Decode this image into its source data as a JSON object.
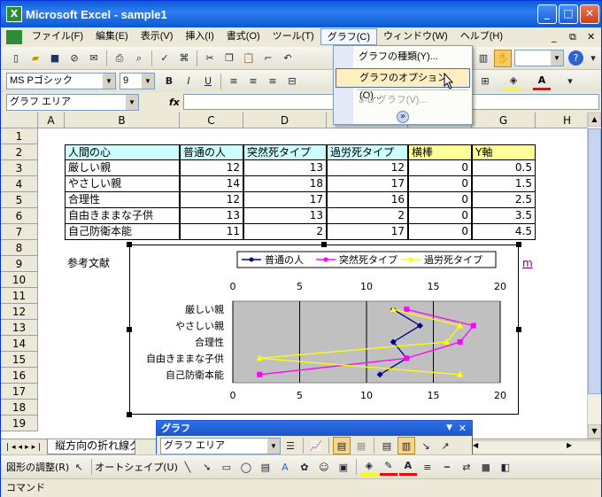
{
  "window": {
    "title": "Microsoft Excel - sample1",
    "app_icon": "X",
    "controls": [
      "_",
      "□",
      "✕"
    ]
  },
  "menubar": {
    "items": [
      "ファイル(F)",
      "編集(E)",
      "表示(V)",
      "挿入(I)",
      "書式(O)",
      "ツール(T)",
      "グラフ(C)",
      "ウィンドウ(W)",
      "ヘルプ(H)"
    ],
    "doc_controls": [
      "_",
      "⧉",
      "✕"
    ]
  },
  "formatting": {
    "font": "MS Pゴシック",
    "size": "9"
  },
  "namebox": {
    "value": "グラフ エリア",
    "fx": "fx"
  },
  "graph_menu": {
    "items": [
      {
        "label": "グラフの種類(Y)...",
        "state": "normal"
      },
      {
        "label": "グラフのオプション(O)...",
        "state": "highlighted"
      },
      {
        "label": "3-D グラフ(V)...",
        "state": "disabled"
      }
    ],
    "expand": "»"
  },
  "columns": [
    "A",
    "B",
    "C",
    "D",
    "E",
    "F",
    "G",
    "H"
  ],
  "rows": [
    "1",
    "2",
    "3",
    "4",
    "5",
    "6",
    "7",
    "8",
    "9",
    "10",
    "11",
    "12",
    "13",
    "14",
    "15",
    "16",
    "17",
    "18",
    "19"
  ],
  "table": {
    "headers": [
      "人間の心",
      "普通の人",
      "突然死タイプ",
      "過労死タイプ",
      "横棒",
      "Y軸"
    ],
    "rows": [
      [
        "厳しい親",
        "12",
        "13",
        "12",
        "0",
        "0.5"
      ],
      [
        "やさしい親",
        "14",
        "18",
        "17",
        "0",
        "1.5"
      ],
      [
        "合理性",
        "12",
        "17",
        "16",
        "0",
        "2.5"
      ],
      [
        "自由きままな子供",
        "13",
        "13",
        "2",
        "0",
        "3.5"
      ],
      [
        "自己防衛本能",
        "11",
        "2",
        "17",
        "0",
        "4.5"
      ]
    ]
  },
  "notes": {
    "reference": "参考文献",
    "link_fragment": "m"
  },
  "colors": {
    "header_cyan": "#ccffff",
    "header_yellow": "#ffff99",
    "plot_gray": "#c0c0c0",
    "series1": "#000080",
    "series2": "#ff00ff",
    "series3": "#ffff00"
  },
  "chart_data": {
    "type": "line",
    "orientation": "horizontal",
    "categories": [
      "厳しい親",
      "やさしい親",
      "合理性",
      "自由きままな子供",
      "自己防衛本能"
    ],
    "series": [
      {
        "name": "普通の人",
        "values": [
          12,
          14,
          12,
          13,
          11
        ],
        "color": "#000080",
        "marker": "diamond"
      },
      {
        "name": "突然死タイプ",
        "values": [
          13,
          18,
          17,
          13,
          2
        ],
        "color": "#ff00ff",
        "marker": "square"
      },
      {
        "name": "過労死タイプ",
        "values": [
          12,
          17,
          16,
          2,
          17
        ],
        "color": "#ffff00",
        "marker": "triangle"
      }
    ],
    "xlim": [
      0,
      20
    ],
    "xticks": [
      "0",
      "5",
      "10",
      "15",
      "20"
    ],
    "grid": true,
    "legend": "top"
  },
  "sheet_tab": {
    "label": "縦方向の折れ線グラフ"
  },
  "chart_toolbar": {
    "title": "グラフ",
    "object": "グラフ エリア"
  },
  "drawing": {
    "adjust": "図形の調整(R)",
    "autoshape": "オートシェイプ(U)"
  },
  "status": {
    "text": "コマンド"
  }
}
